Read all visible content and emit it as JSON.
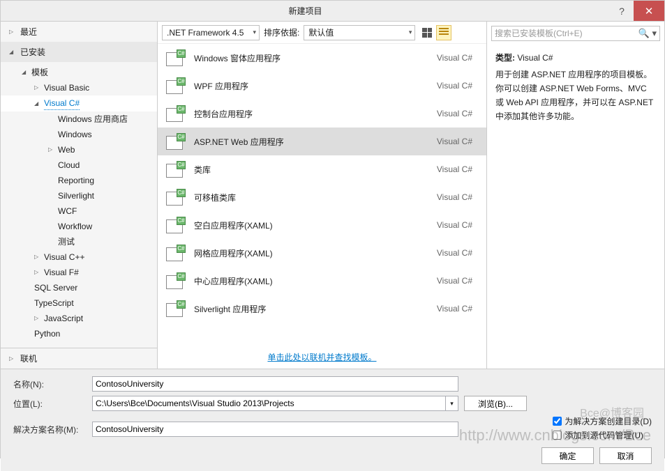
{
  "title": "新建项目",
  "nav": {
    "recent": "最近",
    "installed": "已安装",
    "online": "联机"
  },
  "tree": {
    "templates": "模板",
    "vb": "Visual Basic",
    "csharp": "Visual C#",
    "csharp_nodes": [
      "Windows 应用商店",
      "Windows",
      "Web",
      "Cloud",
      "Reporting",
      "Silverlight",
      "WCF",
      "Workflow",
      "测试"
    ],
    "cpp": "Visual C++",
    "fsharp": "Visual F#",
    "sql": "SQL Server",
    "ts": "TypeScript",
    "js": "JavaScript",
    "python": "Python"
  },
  "toolbar": {
    "framework": ".NET Framework 4.5",
    "sort_label": "排序依据:",
    "sort_value": "默认值"
  },
  "templates": [
    {
      "name": "Windows 窗体应用程序",
      "lang": "Visual C#"
    },
    {
      "name": "WPF 应用程序",
      "lang": "Visual C#"
    },
    {
      "name": "控制台应用程序",
      "lang": "Visual C#"
    },
    {
      "name": "ASP.NET Web 应用程序",
      "lang": "Visual C#",
      "selected": true
    },
    {
      "name": "类库",
      "lang": "Visual C#"
    },
    {
      "name": "可移植类库",
      "lang": "Visual C#"
    },
    {
      "name": "空白应用程序(XAML)",
      "lang": "Visual C#"
    },
    {
      "name": "网格应用程序(XAML)",
      "lang": "Visual C#"
    },
    {
      "name": "中心应用程序(XAML)",
      "lang": "Visual C#"
    },
    {
      "name": "Silverlight 应用程序",
      "lang": "Visual C#"
    }
  ],
  "online_link": "单击此处以联机并查找模板。",
  "search": {
    "placeholder": "搜索已安装模板(Ctrl+E)"
  },
  "info": {
    "type_label": "类型:",
    "type_value": "Visual C#",
    "desc": "用于创建 ASP.NET 应用程序的项目模板。你可以创建 ASP.NET Web Forms、MVC 或 Web API 应用程序，并可以在 ASP.NET 中添加其他许多功能。"
  },
  "form": {
    "name_label": "名称(N):",
    "name_value": "ContosoUniversity",
    "location_label": "位置(L):",
    "location_value": "C:\\Users\\Bce\\Documents\\Visual Studio 2013\\Projects",
    "solution_label": "解决方案名称(M):",
    "solution_value": "ContosoUniversity",
    "browse": "浏览(B)...",
    "create_dir": "为解决方案创建目录(D)",
    "add_scm": "添加到源代码管理(U)",
    "ok": "确定",
    "cancel": "取消"
  },
  "watermark": "http://www.cnblogs.com/Bce",
  "watermark_small": "Bce@博客园"
}
